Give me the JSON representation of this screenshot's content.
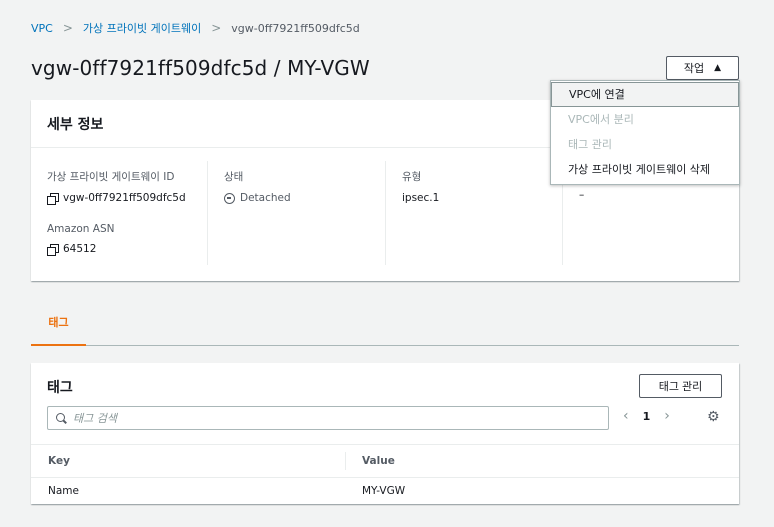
{
  "breadcrumb": {
    "items": [
      "VPC",
      "가상 프라이빗 게이트웨이"
    ],
    "current": "vgw-0ff7921ff509dfc5d",
    "separator": ">"
  },
  "page": {
    "title": "vgw-0ff7921ff509dfc5d / MY-VGW"
  },
  "actions": {
    "label": "작업",
    "caret": "▲",
    "menu": [
      {
        "label": "VPC에 연결",
        "state": "highlighted"
      },
      {
        "label": "VPC에서 분리",
        "state": "disabled"
      },
      {
        "label": "태그 관리",
        "state": "disabled"
      },
      {
        "label": "가상 프라이빗 게이트웨이 삭제",
        "state": "enabled"
      }
    ]
  },
  "details": {
    "title": "세부 정보",
    "vgw_id_label": "가상 프라이빗 게이트웨이 ID",
    "vgw_id_value": "vgw-0ff7921ff509dfc5d",
    "asn_label": "Amazon ASN",
    "asn_value": "64512",
    "state_label": "상태",
    "state_value": "Detached",
    "type_label": "유형",
    "type_value": "ipsec.1",
    "vpc_value": "–"
  },
  "tabs": [
    {
      "label": "태그",
      "active": true
    }
  ],
  "tags": {
    "title": "태그",
    "manage_label": "태그 관리",
    "search_placeholder": "태그 검색",
    "page": "1",
    "columns": [
      "Key",
      "Value"
    ],
    "rows": [
      {
        "key": "Name",
        "value": "MY-VGW"
      }
    ]
  },
  "colors": {
    "link": "#0073bb",
    "accent": "#ec7211",
    "text": "#16191f",
    "muted": "#545b64"
  }
}
